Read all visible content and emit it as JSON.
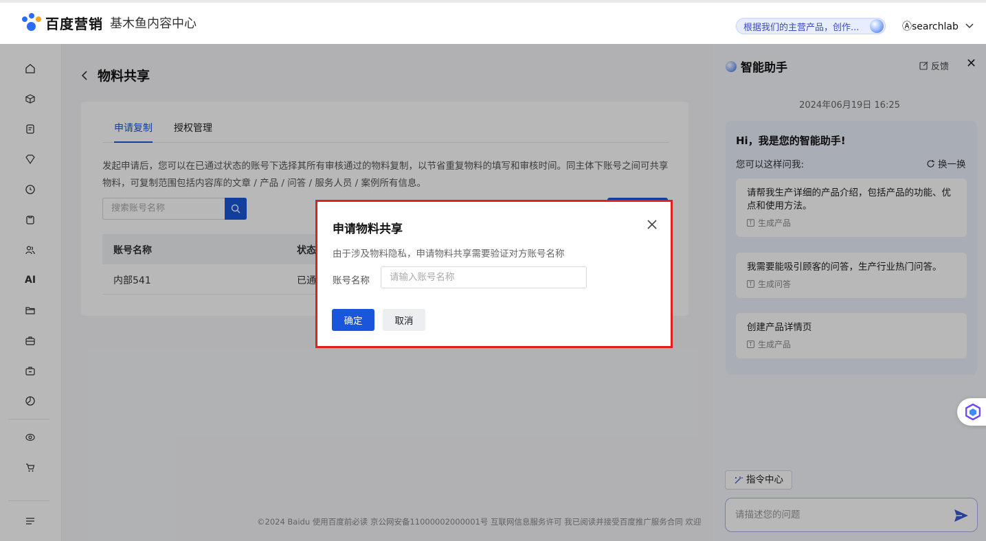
{
  "header": {
    "brand": "百度营销",
    "product": "基木鱼内容中心",
    "prompt_pill": "根据我们的主营产品，创作...",
    "user": "searchlab"
  },
  "sidebar": {
    "icons": [
      "home-icon",
      "cube-icon",
      "document-icon",
      "heart-shield-icon",
      "clock-coin-icon",
      "clipboard-icon",
      "users-icon",
      "ai-icon",
      "folder-icon",
      "briefcase-icon",
      "briefcase-alt-icon",
      "chart-pie-icon",
      "eye-icon",
      "cart-icon",
      "menu-icon"
    ]
  },
  "page": {
    "title": "物料共享",
    "tabs": [
      {
        "label": "申请复制",
        "active": true
      },
      {
        "label": "授权管理",
        "active": false
      }
    ],
    "description": "发起申请后，您可以在已通过状态的账号下选择其所有审核通过的物料复制，以节省重复物料的填写和审核时间。同主体下账号之间可共享物料，可复制范围包括内容库的文章 / 产品 / 问答 / 服务人员 / 案例所有信息。",
    "search_placeholder": "搜索账号名称",
    "table": {
      "columns": [
        "账号名称",
        "状态"
      ],
      "rows": [
        {
          "name": "内部541",
          "status": "已通"
        }
      ]
    },
    "footer": "©2024 Baidu 使用百度前必读 京公网安备11000002000001号 互联网信息服务许可 我已阅读并接受百度推广服务合同 欢迎"
  },
  "modal": {
    "title": "申请物料共享",
    "description": "由于涉及物料隐私，申请物料共享需要验证对方账号名称",
    "field_label": "账号名称",
    "field_placeholder": "请输入账号名称",
    "ok_label": "确定",
    "cancel_label": "取消"
  },
  "assistant": {
    "title": "智能助手",
    "feedback": "反馈",
    "date": "2024年06月19日 16:25",
    "greeting": "Hi，我是您的智能助手!",
    "ask_hint": "您可以这样问我:",
    "refresh": "换一换",
    "suggestions": [
      {
        "text": "请帮我生产详细的产品介绍，包括产品的功能、优点和使用方法。",
        "tag": "生成产品"
      },
      {
        "text": "我需要能吸引顾客的问答，生产行业热门问答。",
        "tag": "生成问答"
      },
      {
        "text": "创建产品详情页",
        "tag": "生成产品"
      }
    ],
    "command_center": "指令中心",
    "input_placeholder": "请描述您的问题"
  },
  "colors": {
    "accent": "#1a56db",
    "highlight_border": "#e02020"
  }
}
